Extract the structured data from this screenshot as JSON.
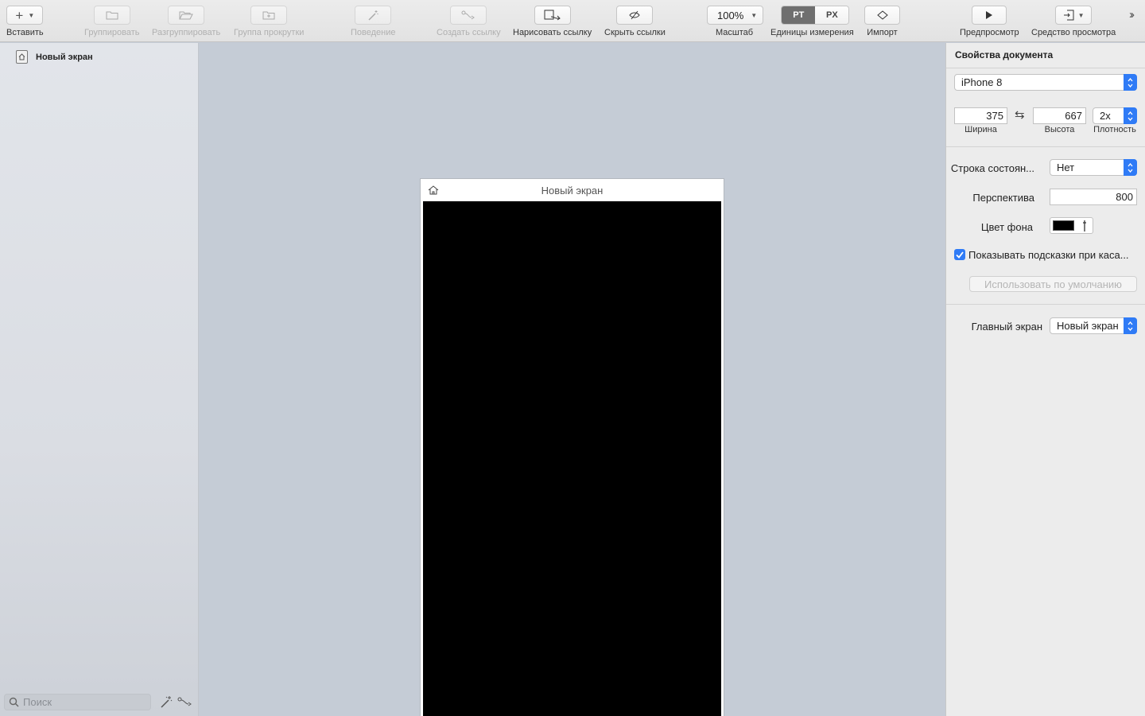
{
  "toolbar": {
    "insert_label": "Вставить",
    "group_label": "Группировать",
    "ungroup_label": "Разгруппировать",
    "scroll_group_label": "Группа прокрутки",
    "behavior_label": "Поведение",
    "create_link_label": "Создать ссылку",
    "draw_link_label": "Нарисовать ссылку",
    "hide_links_label": "Скрыть ссылки",
    "zoom_value": "100%",
    "zoom_label": "Масштаб",
    "units_pt": "PT",
    "units_px": "PX",
    "units_label": "Единицы измерения",
    "import_label": "Импорт",
    "preview_label": "Предпросмотр",
    "viewer_label": "Средство просмотра"
  },
  "layers": {
    "items": [
      {
        "label": "Новый экран"
      }
    ],
    "search_placeholder": "Поиск"
  },
  "canvas": {
    "screen_title": "Новый экран",
    "background_color": "#000000"
  },
  "inspector": {
    "title": "Свойства документа",
    "device": "iPhone 8",
    "width_value": "375",
    "height_value": "667",
    "density_value": "2x",
    "width_label": "Ширина",
    "height_label": "Высота",
    "density_label": "Плотность",
    "status_bar_label": "Строка состоян...",
    "status_bar_value": "Нет",
    "perspective_label": "Перспектива",
    "perspective_value": "800",
    "bg_color_label": "Цвет фона",
    "show_hints_label": "Показывать подсказки при каса...",
    "show_hints_checked": true,
    "use_default_label": "Использовать по умолчанию",
    "main_screen_label": "Главный экран",
    "main_screen_value": "Новый экран"
  },
  "colors": {
    "accent": "#2f7bf6",
    "canvas_bg": "#c5ccd6"
  }
}
